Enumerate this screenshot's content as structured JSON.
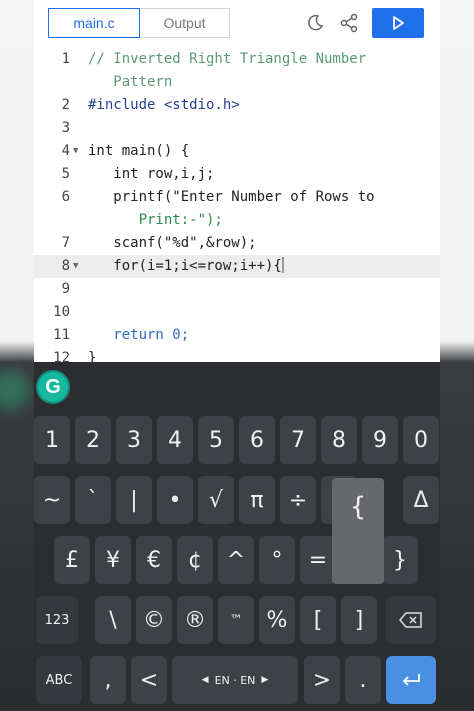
{
  "topbar": {
    "tab_main": "main.c",
    "tab_output": "Output",
    "icons": [
      "moon-icon",
      "share-icon",
      "play-icon"
    ]
  },
  "editor": {
    "lines": [
      {
        "num": "1",
        "text": "// Inverted Right Triangle Number"
      },
      {
        "num": "",
        "text": "   Pattern"
      },
      {
        "num": "2",
        "text": "#include <stdio.h>"
      },
      {
        "num": "3",
        "text": ""
      },
      {
        "num": "4",
        "text": "int main() {"
      },
      {
        "num": "5",
        "text": "   int row,i,j;"
      },
      {
        "num": "6",
        "text": "   printf(\"Enter Number of Rows to"
      },
      {
        "num": "",
        "text": "      Print:-\");"
      },
      {
        "num": "7",
        "text": "   scanf(\"%d\",&row);"
      },
      {
        "num": "8",
        "text": "   for(i=1;i<=row;i++){"
      },
      {
        "num": "9",
        "text": ""
      },
      {
        "num": "10",
        "text": ""
      },
      {
        "num": "11",
        "text": "   return 0;"
      },
      {
        "num": "12",
        "text": "}"
      }
    ]
  },
  "keyboard": {
    "grammarly_label": "G",
    "row1": [
      "1",
      "2",
      "3",
      "4",
      "5",
      "6",
      "7",
      "8",
      "9",
      "0"
    ],
    "row2": [
      "~",
      "`",
      "|",
      "•",
      "√",
      "π",
      "÷",
      "{",
      "Δ"
    ],
    "row3": [
      "£",
      "¥",
      "€",
      "¢",
      "^",
      "°",
      "=",
      "}"
    ],
    "row4": [
      "123",
      "\\",
      "©",
      "®",
      "™",
      "%",
      "[",
      "]"
    ],
    "row5": [
      "ABC",
      ",",
      "<",
      "EN · EN",
      ">",
      "."
    ],
    "popup_key": "{",
    "colors": {
      "keyboard_bg": "#2b2d30",
      "key_bg": "#3e4145",
      "enter_bg": "#4a90e2",
      "accent": "#1f6feb"
    }
  }
}
